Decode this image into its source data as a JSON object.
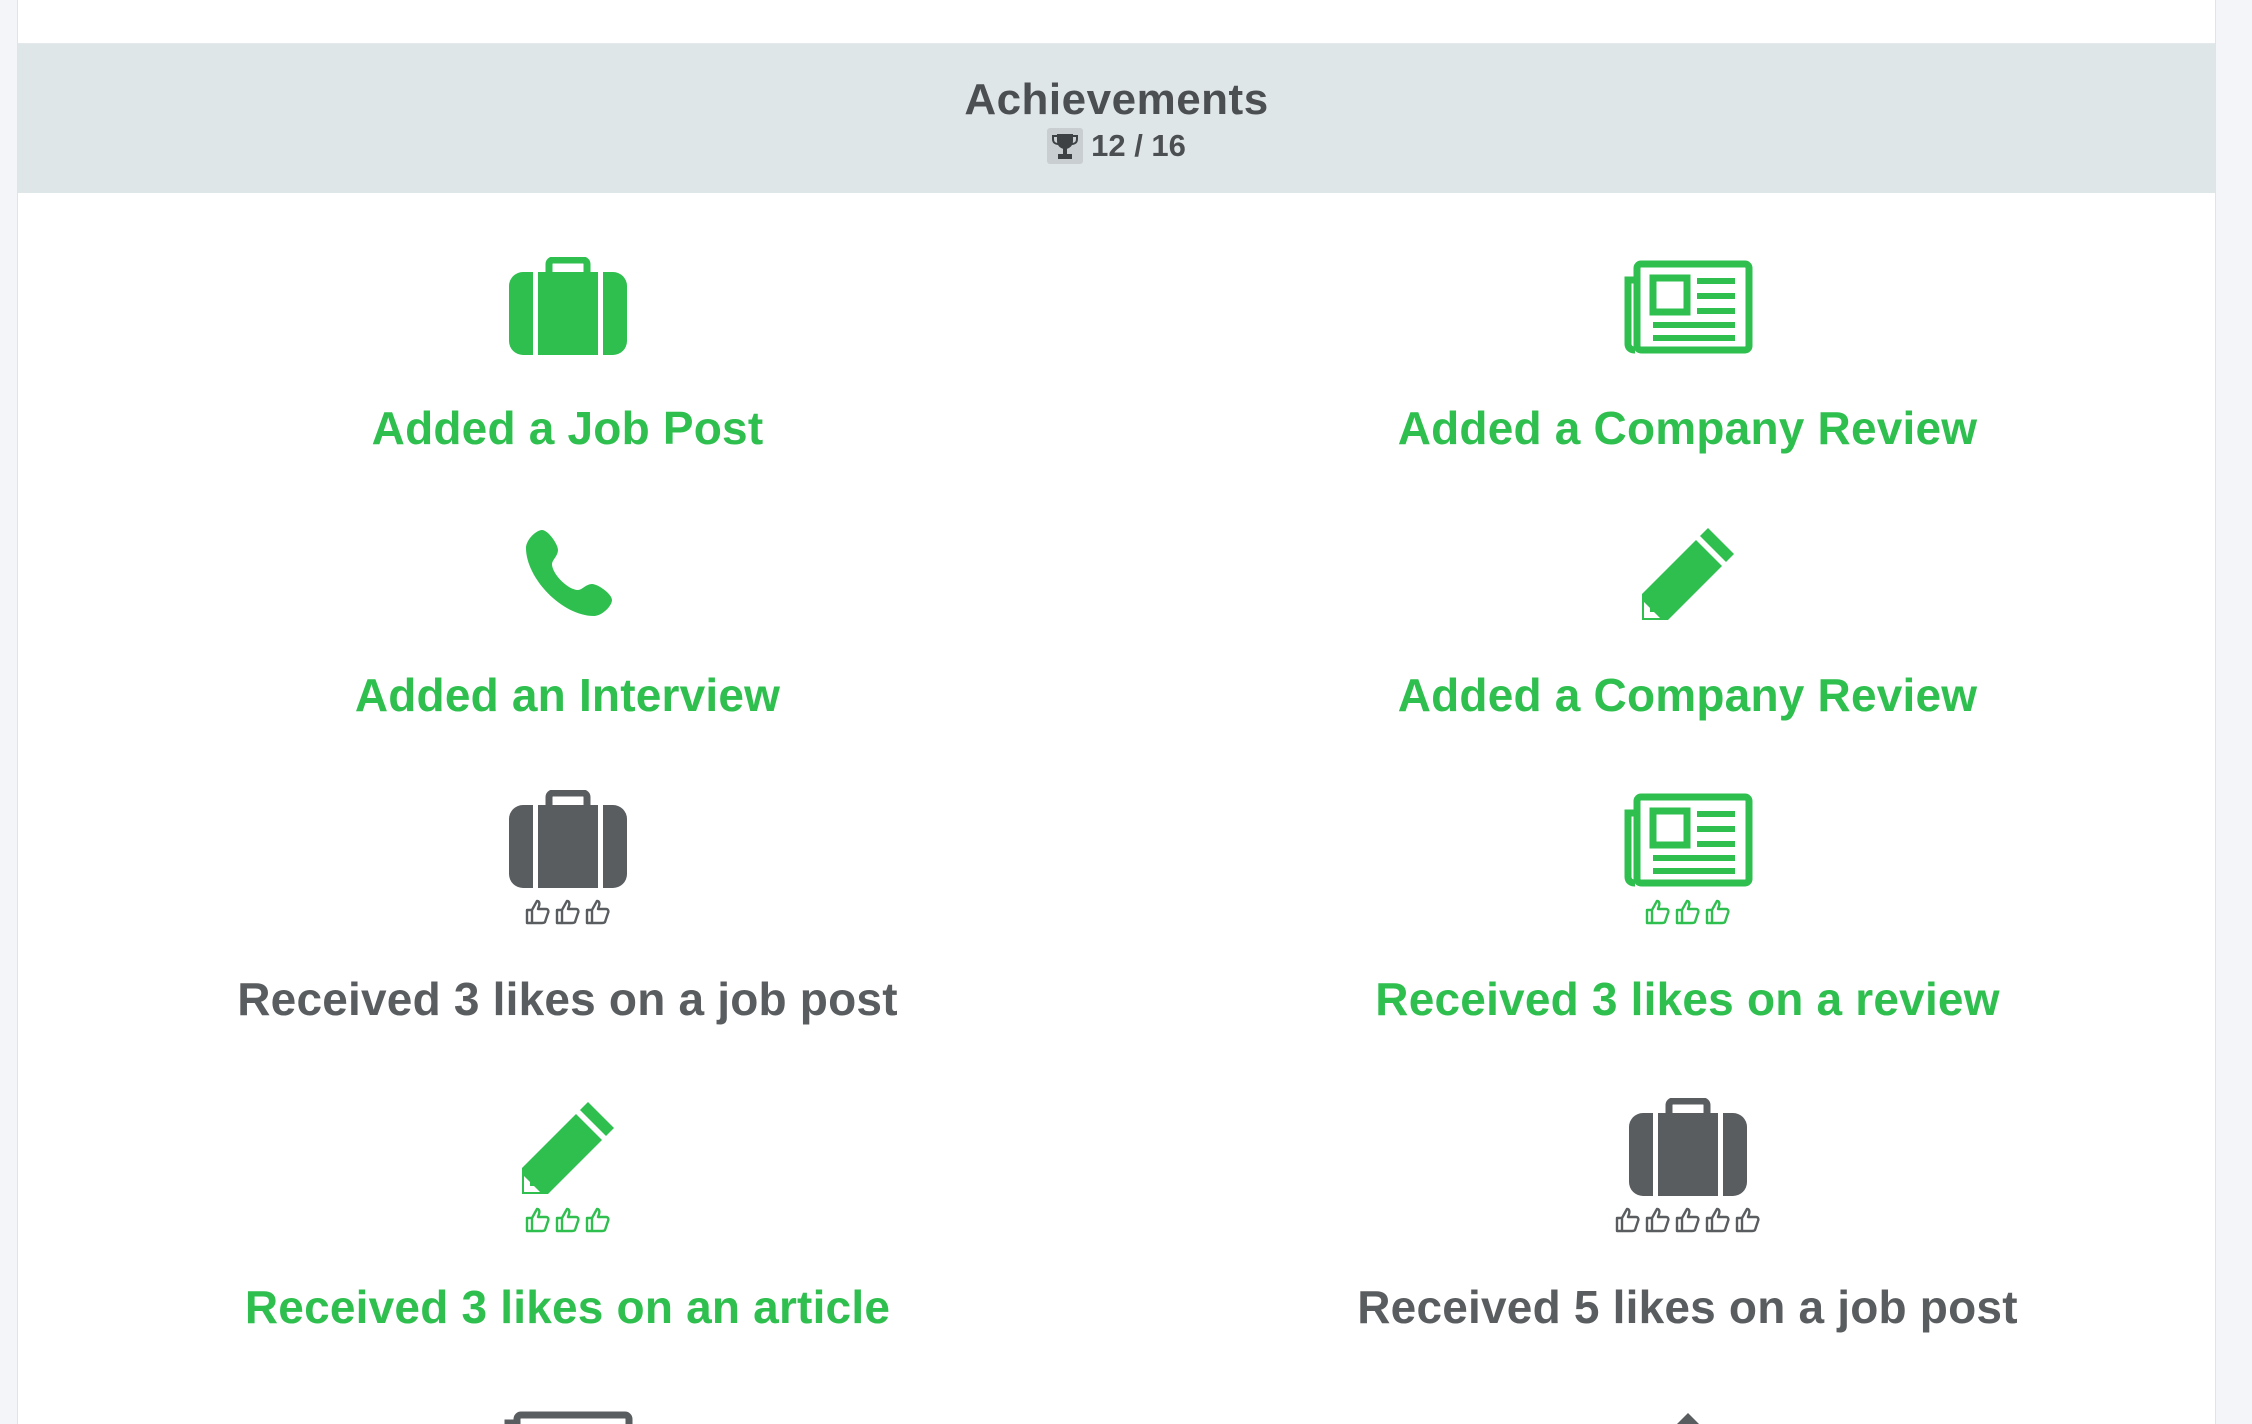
{
  "header": {
    "title": "Achievements",
    "count": "12 / 16",
    "trophy_icon": "trophy-icon"
  },
  "colors": {
    "earned": "#2ebf4f",
    "unearned": "#5a5d60",
    "header_bg": "#dfe6e8"
  },
  "achievements": [
    {
      "label": "Added a Job Post",
      "icon": "briefcase-icon",
      "earned": true,
      "likes": 0
    },
    {
      "label": "Added a Company Review",
      "icon": "newspaper-icon",
      "earned": true,
      "likes": 0
    },
    {
      "label": "Added an Interview",
      "icon": "phone-icon",
      "earned": true,
      "likes": 0
    },
    {
      "label": "Added a Company Review",
      "icon": "pencil-icon",
      "earned": true,
      "likes": 0
    },
    {
      "label": "Received 3 likes on a job post",
      "icon": "briefcase-icon",
      "earned": false,
      "likes": 3
    },
    {
      "label": "Received 3 likes on a review",
      "icon": "newspaper-icon",
      "earned": true,
      "likes": 3
    },
    {
      "label": "Received 3 likes on an article",
      "icon": "pencil-icon",
      "earned": true,
      "likes": 3
    },
    {
      "label": "Received 5 likes on a job post",
      "icon": "briefcase-icon",
      "earned": false,
      "likes": 5
    }
  ]
}
